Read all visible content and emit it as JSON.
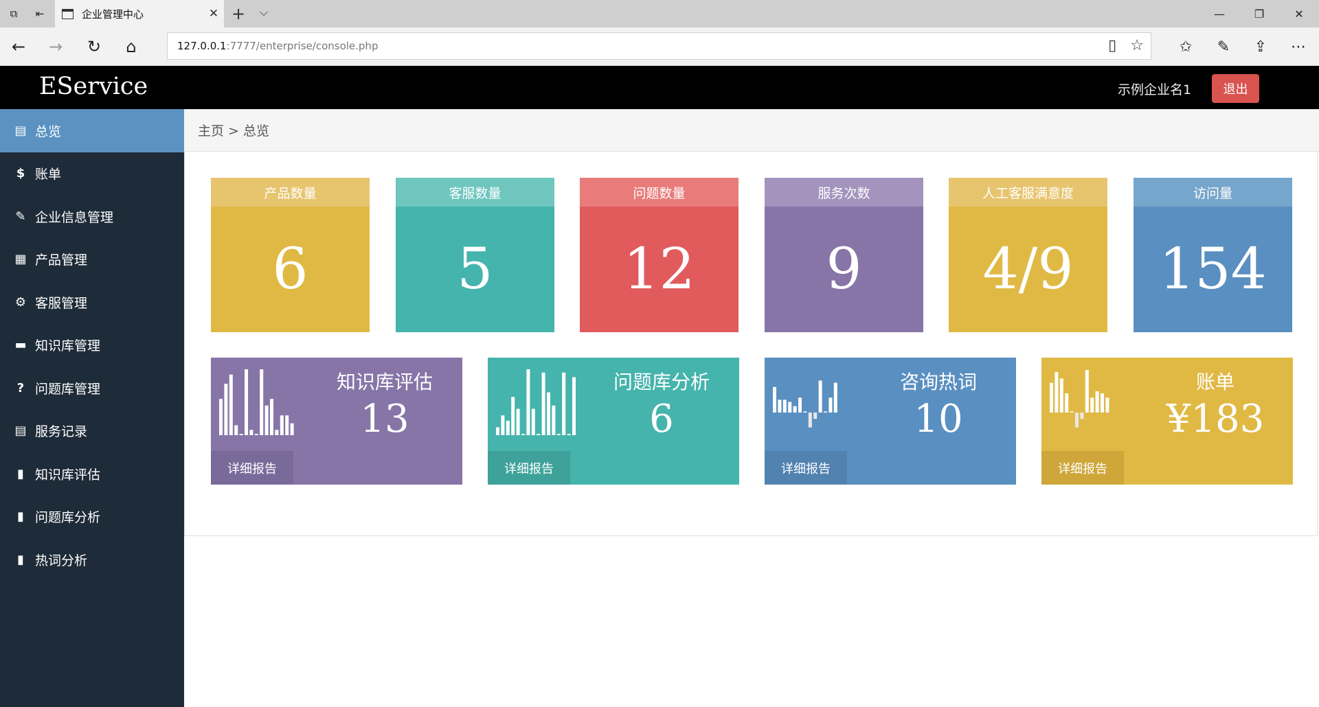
{
  "browser": {
    "tab_title": "企业管理中心",
    "url_host": "127.0.0.1",
    "url_rest": ":7777/enterprise/console.php"
  },
  "header": {
    "brand": "EService",
    "company_name": "示例企业名1",
    "logout_label": "退出"
  },
  "sidebar": {
    "items": [
      {
        "label": "总览",
        "icon": "list-icon",
        "glyph": "▤",
        "active": true
      },
      {
        "label": "账单",
        "icon": "dollar-icon",
        "glyph": "$",
        "active": false
      },
      {
        "label": "企业信息管理",
        "icon": "edit-icon",
        "glyph": "✎",
        "active": false
      },
      {
        "label": "产品管理",
        "icon": "grid-icon",
        "glyph": "▦",
        "active": false
      },
      {
        "label": "客服管理",
        "icon": "gear-icon",
        "glyph": "⚙",
        "active": false
      },
      {
        "label": "知识库管理",
        "icon": "briefcase-icon",
        "glyph": "▬",
        "active": false
      },
      {
        "label": "问题库管理",
        "icon": "question-icon",
        "glyph": "?",
        "active": false
      },
      {
        "label": "服务记录",
        "icon": "list-icon",
        "glyph": "▤",
        "active": false
      },
      {
        "label": "知识库评估",
        "icon": "bar-chart-icon",
        "glyph": "▮",
        "active": false
      },
      {
        "label": "问题库分析",
        "icon": "bar-chart-icon",
        "glyph": "▮",
        "active": false
      },
      {
        "label": "热词分析",
        "icon": "bar-chart-icon",
        "glyph": "▮",
        "active": false
      }
    ]
  },
  "breadcrumb": "主页 > 总览",
  "stats": [
    {
      "label": "产品数量",
      "value": "6",
      "head_color": "#e7c46e",
      "body_color": "#e0b944"
    },
    {
      "label": "客服数量",
      "value": "5",
      "head_color": "#6ec6bf",
      "body_color": "#45b4ac"
    },
    {
      "label": "问题数量",
      "value": "12",
      "head_color": "#e97c7a",
      "body_color": "#e15b5d"
    },
    {
      "label": "服务次数",
      "value": "9",
      "head_color": "#a393bd",
      "body_color": "#8775a8"
    },
    {
      "label": "人工客服满意度",
      "value": "4/9",
      "head_color": "#e7c46e",
      "body_color": "#e0b944"
    },
    {
      "label": "访问量",
      "value": "154",
      "head_color": "#77a6cc",
      "body_color": "#5a8fc1"
    }
  ],
  "cards": [
    {
      "title": "知识库评估",
      "value": "13",
      "button": "详细报告",
      "color": "#8775a8",
      "btn_color": "#7a6a9a",
      "bars": [
        0.55,
        0.78,
        0.92,
        0.15,
        0.02,
        1.0,
        0.08,
        0.02,
        1.0,
        0.45,
        0.55,
        0.08,
        0.3,
        0.3,
        0.18
      ]
    },
    {
      "title": "问题库分析",
      "value": "6",
      "button": "详细报告",
      "color": "#45b4ac",
      "btn_color": "#3ea29b",
      "bars": [
        0.12,
        0.3,
        0.22,
        0.58,
        0.4,
        0.02,
        1.0,
        0.4,
        0.02,
        0.95,
        0.65,
        0.45,
        0.02,
        0.95,
        0.02,
        0.88
      ]
    },
    {
      "title": "咨询热词",
      "value": "10",
      "button": "详细报告",
      "color": "#5a8fc1",
      "btn_color": "#5182b0",
      "bars": [
        0.6,
        0.3,
        0.3,
        0.25,
        0.15,
        0.35,
        0.0,
        -0.35,
        -0.15,
        0.75,
        0.0,
        0.35,
        0.7
      ]
    },
    {
      "title": "账单",
      "value": "¥183",
      "button": "详细报告",
      "color": "#e0b944",
      "btn_color": "#cea63a",
      "bars": [
        0.7,
        0.95,
        0.8,
        0.45,
        0.0,
        -0.35,
        -0.15,
        1.0,
        0.35,
        0.5,
        0.45,
        0.35
      ]
    }
  ]
}
